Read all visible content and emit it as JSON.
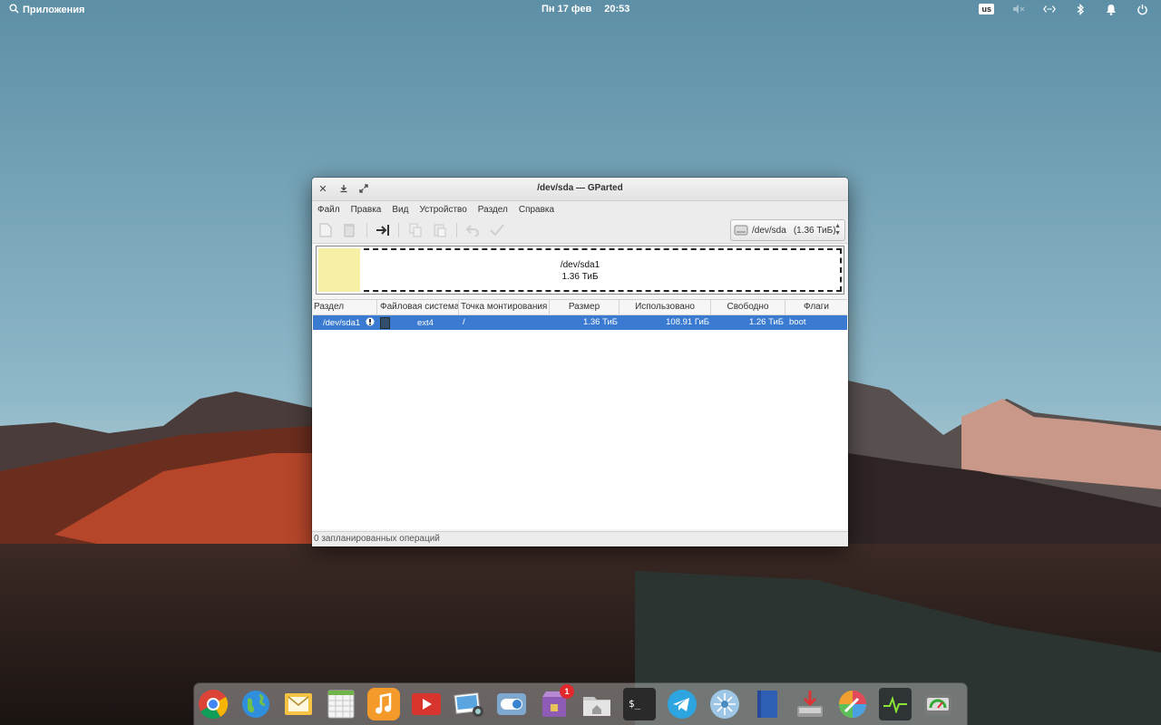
{
  "top_panel": {
    "apps_label": "Приложения",
    "date": "Пн 17 фев",
    "time": "20:53",
    "keyboard_layout": "us"
  },
  "window": {
    "title": "/dev/sda — GParted",
    "menu": [
      "Файл",
      "Правка",
      "Вид",
      "Устройство",
      "Раздел",
      "Справка"
    ],
    "device_selector": {
      "device": "/dev/sda",
      "size": "(1.36 ТиБ)"
    },
    "partition_graph": {
      "name": "/dev/sda1",
      "size": "1.36 ТиБ",
      "used_fraction": 0.08
    },
    "table": {
      "columns": [
        "Раздел",
        "Файловая система",
        "Точка монтирования",
        "Размер",
        "Использовано",
        "Свободно",
        "Флаги"
      ],
      "rows": [
        {
          "partition": "/dev/sda1",
          "filesystem": "ext4",
          "mount_point": "/",
          "size": "1.36 ТиБ",
          "used": "108.91 ГиБ",
          "free": "1.26 ТиБ",
          "flags": "boot"
        }
      ]
    },
    "status": "0 запланированных операций"
  },
  "colors": {
    "selection": "#3a7bd1",
    "ext4": "#314e6c",
    "used_space": "#f5f0a3"
  },
  "dock": {
    "apps": [
      "chrome",
      "browser",
      "mail",
      "spreadsheet",
      "music",
      "videos",
      "photos",
      "settings",
      "appcenter",
      "files",
      "terminal",
      "telegram",
      "network",
      "book",
      "installer",
      "color-picker",
      "system-monitor",
      "disk-utility"
    ],
    "appcenter_badge": "1"
  }
}
